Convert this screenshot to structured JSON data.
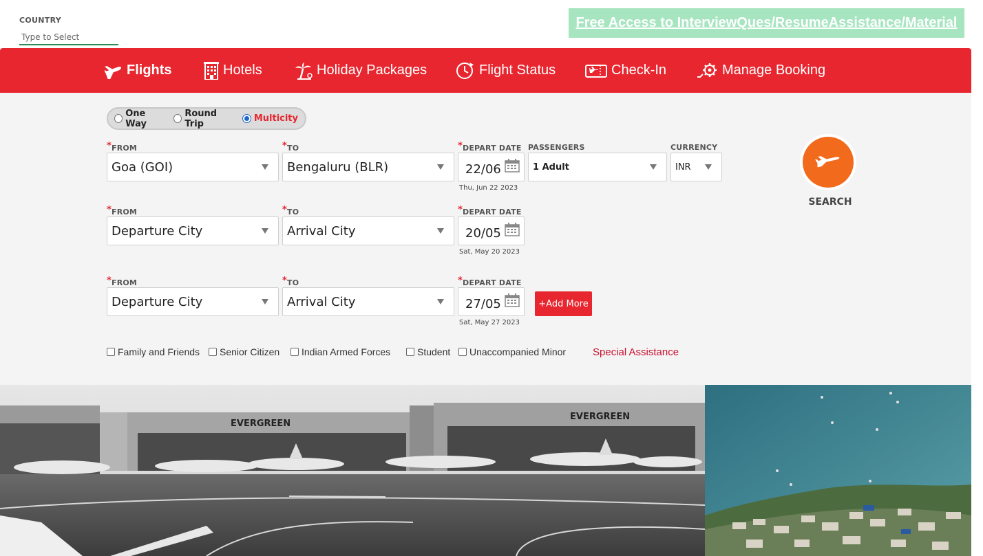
{
  "country": {
    "label": "COUNTRY",
    "placeholder": "Type to Select"
  },
  "promo": {
    "text": "Free Access to InterviewQues/ResumeAssistance/Material"
  },
  "nav": {
    "flights": "Flights",
    "hotels": "Hotels",
    "holiday": "Holiday Packages",
    "flight_status": "Flight Status",
    "checkin": "Check-In",
    "manage": "Manage Booking"
  },
  "trip_type": {
    "one_way": "One Way",
    "round_trip": "Round Trip",
    "multicity": "Multicity",
    "selected": "Multicity"
  },
  "labels": {
    "from": "FROM",
    "to": "TO",
    "depart": "DEPART DATE",
    "passengers": "PASSENGERS",
    "currency": "CURRENCY"
  },
  "legs": [
    {
      "from": "Goa (GOI)",
      "to": "Bengaluru (BLR)",
      "date": "22/06",
      "date_full": "Thu, Jun 22 2023"
    },
    {
      "from": "Departure City",
      "to": "Arrival City",
      "date": "20/05",
      "date_full": "Sat, May 20 2023"
    },
    {
      "from": "Departure City",
      "to": "Arrival City",
      "date": "27/05",
      "date_full": "Sat, May 27 2023"
    }
  ],
  "passengers": "1 Adult",
  "currency": "INR",
  "add_more": "+Add More",
  "search_label": "SEARCH",
  "options": {
    "family": "Family and Friends",
    "senior": "Senior Citizen",
    "armed": "Indian Armed Forces",
    "student": "Student",
    "minor": "Unaccompanied Minor"
  },
  "special_assistance": "Special Assistance",
  "photo_left": {
    "hangar_text": "EVERGREEN"
  },
  "colors": {
    "brand_red": "#e8262f",
    "search_orange": "#f26a1c",
    "promo_green": "#a6e5c0",
    "panel_bg": "#f4f4f4"
  }
}
